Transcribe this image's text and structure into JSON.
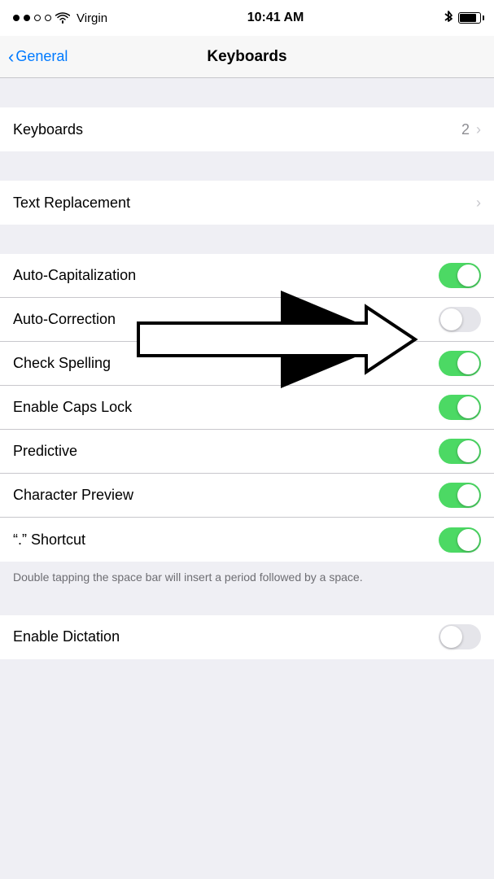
{
  "statusBar": {
    "carrier": "Virgin",
    "time": "10:41 AM",
    "bluetooth": "BT",
    "battery": 85
  },
  "navBar": {
    "backLabel": "General",
    "title": "Keyboards"
  },
  "sections": {
    "keyboardsRow": {
      "label": "Keyboards",
      "value": "2"
    },
    "textReplacementRow": {
      "label": "Text Replacement"
    },
    "toggleRows": [
      {
        "label": "Auto-Capitalization",
        "state": "on"
      },
      {
        "label": "Auto-Correction",
        "state": "off"
      },
      {
        "label": "Check Spelling",
        "state": "on"
      },
      {
        "label": "Enable Caps Lock",
        "state": "on"
      },
      {
        "label": "Predictive",
        "state": "on"
      },
      {
        "label": "Character Preview",
        "state": "on"
      },
      {
        "label": "“.” Shortcut",
        "state": "on"
      }
    ],
    "footerNote": "Double tapping the space bar will insert a period followed by a space.",
    "enableDictationRow": {
      "label": "Enable Dictation",
      "state": "off"
    }
  }
}
